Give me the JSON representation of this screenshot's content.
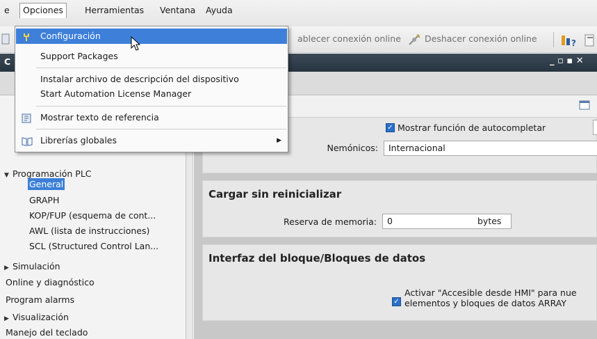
{
  "menubar": {
    "edge_char": "e",
    "items": [
      {
        "label": "Opciones"
      },
      {
        "label": "Herramientas"
      },
      {
        "label": "Ventana"
      },
      {
        "label": "Ayuda"
      }
    ]
  },
  "toolbar": {
    "connect_online": "ablecer conexión online",
    "disconnect_online": "Deshacer conexión online"
  },
  "titlebar": {
    "glyph": "C",
    "controls": "_ ▫ ▪ ✕"
  },
  "opciones_menu": {
    "items": [
      {
        "label": "Configuración",
        "icon": "wrench-icon",
        "highlighted": true
      },
      {
        "label": "Support Packages"
      },
      {
        "label": "Instalar archivo de descripción del dispositivo"
      },
      {
        "label": "Start Automation License Manager"
      },
      {
        "label": "Mostrar texto de referencia",
        "icon": "reference-text-icon"
      },
      {
        "label": "Librerías globales",
        "icon": "library-book-icon",
        "has_submenu": true
      }
    ]
  },
  "tree": {
    "items": [
      {
        "label": "Programación PLC",
        "expanded": true
      },
      {
        "label": "General",
        "selected": true
      },
      {
        "label": "GRAPH"
      },
      {
        "label": "KOP/FUP (esquema de cont..."
      },
      {
        "label": "AWL (lista de instrucciones)"
      },
      {
        "label": "SCL (Structured Control Lan..."
      },
      {
        "label": "Simulación",
        "collapsed": true
      },
      {
        "label": "Online y diagnóstico"
      },
      {
        "label": "Program alarms"
      },
      {
        "label": "Visualización",
        "collapsed": true
      },
      {
        "label": "Manejo del teclado"
      }
    ]
  },
  "general_section": {
    "autocomplete_label": "Mostrar función de autocompletar",
    "autocomplete_checked": true,
    "mnemonics_label": "Nemónicos:",
    "mnemonics_value": "Internacional"
  },
  "reload_section": {
    "title": "Cargar sin reinicializar",
    "memory_label": "Reserva de memoria:",
    "memory_value": "0",
    "memory_unit": "bytes"
  },
  "interface_section": {
    "title": "Interfaz del bloque/Bloques de datos",
    "hmi_line1": "Activar \"Accesible desde HMI\" para nue",
    "hmi_line2": "elementos y bloques de datos ARRAY",
    "hmi_checked": true
  },
  "colors": {
    "highlight": "#3d7fd9",
    "titlebar": "#2e3b47"
  }
}
